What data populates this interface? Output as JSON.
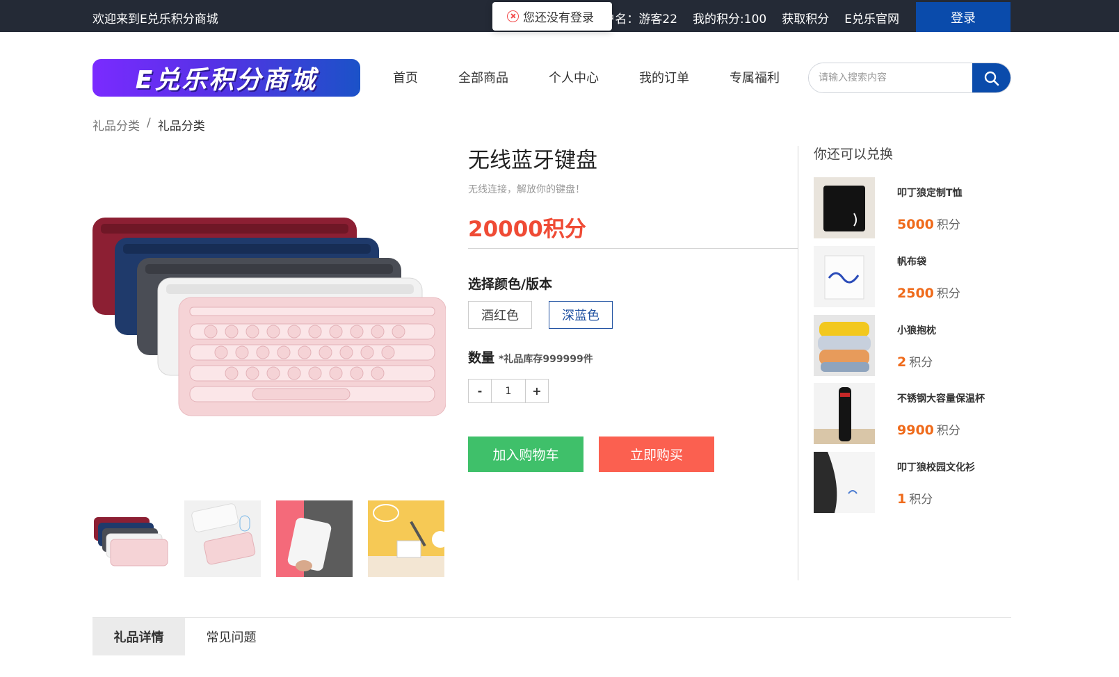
{
  "topbar": {
    "welcome": "欢迎来到E兑乐积分商城",
    "user_label": "户名：游客22",
    "points_label": "我的积分:100",
    "earn_points": "获取积分",
    "official_site": "E兑乐官网",
    "login": "登录"
  },
  "toast": {
    "message": "您还没有登录",
    "icon": "error-circle-icon"
  },
  "header": {
    "logo_text": "E兑乐积分商城",
    "nav": [
      "首页",
      "全部商品",
      "个人中心",
      "我的订单",
      "专属福利"
    ],
    "search_placeholder": "请输入搜索内容"
  },
  "breadcrumb": {
    "parent": "礼品分类",
    "separator": "/",
    "current": "礼品分类"
  },
  "product": {
    "title": "无线蓝牙键盘",
    "subtitle": "无线连接，解放你的键盘！",
    "price": "20000积分",
    "options_title": "选择颜色/版本",
    "options": [
      "酒红色",
      "深蓝色"
    ],
    "selected_option": "深蓝色",
    "qty_title": "数量",
    "stock_note": "*礼品库存999999件",
    "qty_minus": "-",
    "qty_value": "1",
    "qty_plus": "+",
    "add_to_cart": "加入购物车",
    "buy_now": "立即购买"
  },
  "sidebar": {
    "title": "你还可以兑换",
    "unit": "积分",
    "items": [
      {
        "name": "叩丁狼定制T恤",
        "points": "5000"
      },
      {
        "name": "帆布袋",
        "points": "2500"
      },
      {
        "name": "小狼抱枕",
        "points": "2"
      },
      {
        "name": "不锈钢大容量保温杯",
        "points": "9900"
      },
      {
        "name": "叩丁狼校园文化衫",
        "points": "1"
      }
    ]
  },
  "tabs": {
    "details": "礼品详情",
    "faq": "常见问题"
  },
  "colors": {
    "topbar": "#242a36",
    "brand_blue": "#0a4bab",
    "price_red": "#ef4b35",
    "cart_green": "#3fc06a",
    "buy_red": "#fb6050",
    "side_price": "#ef6a1a"
  }
}
